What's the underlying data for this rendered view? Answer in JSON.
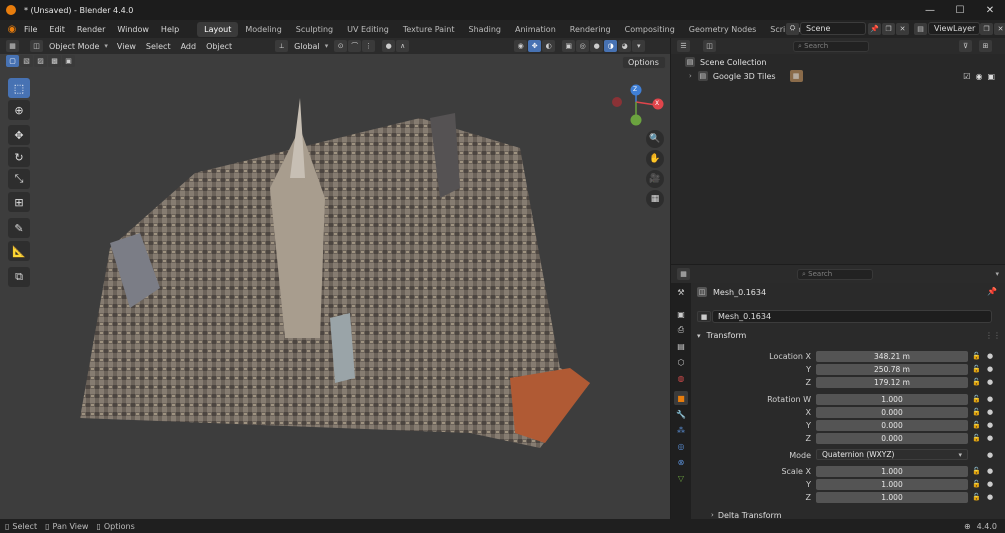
{
  "window": {
    "title": "* (Unsaved) - Blender 4.4.0",
    "minimize": "—",
    "maximize": "☐",
    "close": "✕"
  },
  "menu": [
    "File",
    "Edit",
    "Render",
    "Window",
    "Help"
  ],
  "workspaces": [
    "Layout",
    "Modeling",
    "Sculpting",
    "UV Editing",
    "Texture Paint",
    "Shading",
    "Animation",
    "Rendering",
    "Compositing",
    "Geometry Nodes",
    "Scripting"
  ],
  "active_workspace": "Layout",
  "add_workspace": "+",
  "scene": {
    "label": "Scene",
    "view_layer": "ViewLayer"
  },
  "viewport": {
    "mode": "Object Mode",
    "menus": [
      "View",
      "Select",
      "Add",
      "Object"
    ],
    "transform_orientation": "Global",
    "options_label": "Options",
    "gizmo": {
      "x": "X",
      "y": "Y",
      "z": "Z"
    }
  },
  "outliner": {
    "search_placeholder": "Search",
    "collection": "Scene Collection",
    "items": [
      {
        "label": "Google 3D Tiles"
      }
    ]
  },
  "properties": {
    "search_placeholder": "Search",
    "object_name": "Mesh_0.1634",
    "mesh_name": "Mesh_0.1634",
    "transform_title": "Transform",
    "location": {
      "label": "Location X",
      "x": "348.21 m",
      "y": "250.78 m",
      "z": "179.12 m"
    },
    "rotation": {
      "label": "Rotation W",
      "w": "1.000",
      "x": "0.000",
      "y": "0.000",
      "z": "0.000"
    },
    "mode_label": "Mode",
    "mode_value": "Quaternion (WXYZ)",
    "scale": {
      "label": "Scale X",
      "x": "1.000",
      "y": "1.000",
      "z": "1.000"
    },
    "axis_y": "Y",
    "axis_z": "Z",
    "axis_x": "X",
    "delta_transform": "Delta Transform"
  },
  "status_bar": {
    "select": "Select",
    "pan_view": "Pan View",
    "options": "Options",
    "version": "4.4.0"
  },
  "colors": {
    "accent_blue": "#4772b3",
    "x_axis": "#e0454b",
    "y_axis": "#6ba33f",
    "z_axis": "#3f7fd6",
    "blender_orange": "#e87d0d"
  }
}
